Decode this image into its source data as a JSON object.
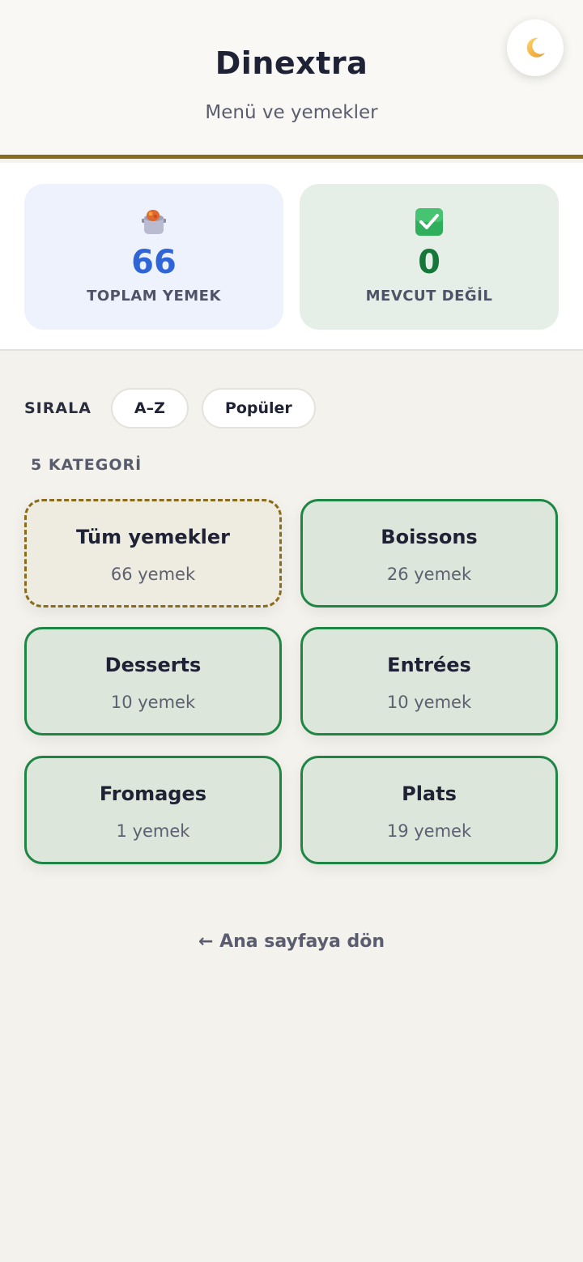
{
  "header": {
    "title": "Dinextra",
    "subtitle": "Menü ve yemekler",
    "theme_icon": "moon-icon"
  },
  "stats": {
    "total": {
      "icon": "cooking-pot-icon",
      "value": "66",
      "label": "TOPLAM YEMEK"
    },
    "unavailable": {
      "icon": "check-mark-icon",
      "value": "0",
      "label": "MEVCUT DEĞİL"
    }
  },
  "sort": {
    "label": "SIRALA",
    "options": [
      "A–Z",
      "Popüler"
    ]
  },
  "categories": {
    "count_label": "5 KATEGORİ",
    "items": [
      {
        "name": "Tüm yemekler",
        "count": "66 yemek"
      },
      {
        "name": "Boissons",
        "count": "26 yemek"
      },
      {
        "name": "Desserts",
        "count": "10 yemek"
      },
      {
        "name": "Entrées",
        "count": "10 yemek"
      },
      {
        "name": "Fromages",
        "count": "1 yemek"
      },
      {
        "name": "Plats",
        "count": "19 yemek"
      }
    ]
  },
  "footer": {
    "back_link": "← Ana sayfaya dön"
  },
  "colors": {
    "accent": "#8a6d1c",
    "total_blue": "#2f65d6",
    "available_green": "#17773a",
    "category_border": "#1e8544"
  }
}
